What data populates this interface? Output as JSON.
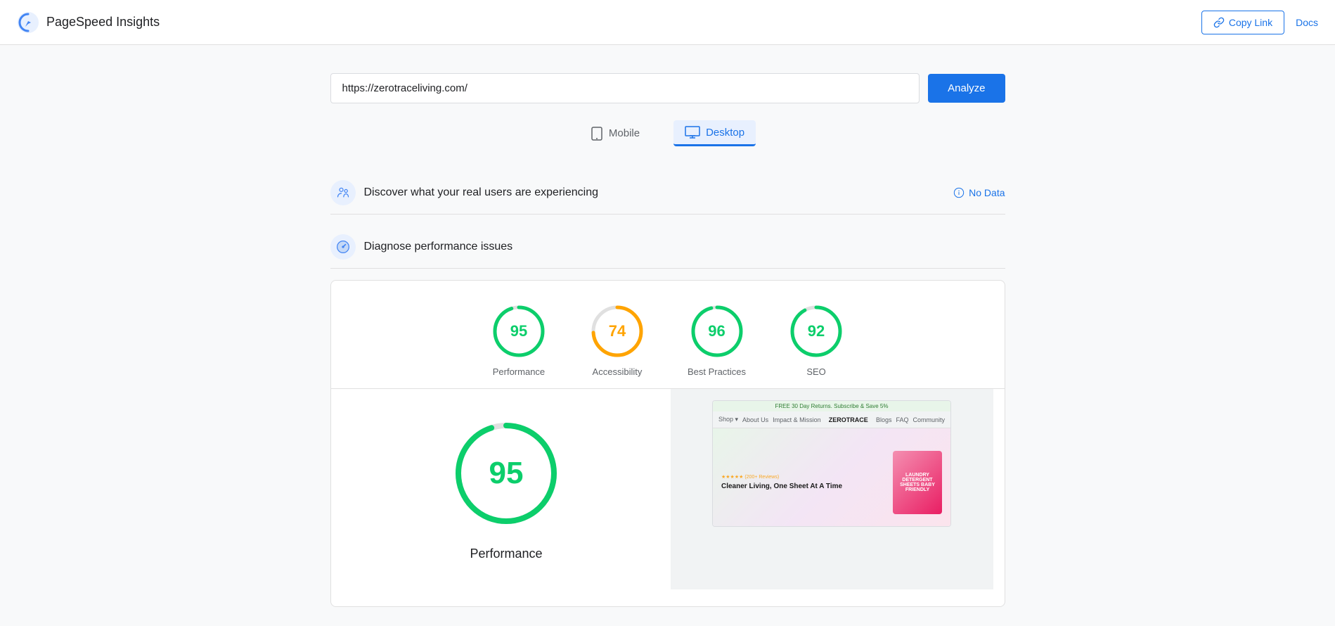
{
  "header": {
    "app_title": "PageSpeed Insights",
    "copy_link_label": "Copy Link",
    "docs_label": "Docs"
  },
  "search": {
    "url_value": "https://zerotraceliving.com/",
    "url_placeholder": "Enter a web page URL",
    "analyze_label": "Analyze"
  },
  "device_tabs": [
    {
      "id": "mobile",
      "label": "Mobile",
      "active": false
    },
    {
      "id": "desktop",
      "label": "Desktop",
      "active": true
    }
  ],
  "sections": {
    "discover": {
      "title": "Discover what your real users are experiencing",
      "no_data_label": "No Data"
    },
    "diagnose": {
      "title": "Diagnose performance issues"
    }
  },
  "scores": [
    {
      "id": "performance",
      "value": "95",
      "label": "Performance",
      "color": "#0cce6b",
      "stroke": "#0cce6b",
      "bg": "#fff",
      "pct": 95
    },
    {
      "id": "accessibility",
      "value": "74",
      "label": "Accessibility",
      "color": "#ffa400",
      "stroke": "#ffa400",
      "bg": "#fff",
      "pct": 74
    },
    {
      "id": "best-practices",
      "value": "96",
      "label": "Best Practices",
      "color": "#0cce6b",
      "stroke": "#0cce6b",
      "bg": "#fff",
      "pct": 96
    },
    {
      "id": "seo",
      "value": "92",
      "label": "SEO",
      "color": "#0cce6b",
      "stroke": "#0cce6b",
      "bg": "#fff",
      "pct": 92
    }
  ],
  "big_score": {
    "value": "95",
    "label": "Performance"
  },
  "screenshot": {
    "site_name": "ZEROTRACE",
    "headline": "Cleaner Living, One Sheet At A Time",
    "product_label": "LAUNDRY DETERGENT SHEETS BABY FRIENDLY",
    "banner_text": "FREE 30 Day Returns. Subscribe & Save 5%"
  },
  "colors": {
    "green": "#0cce6b",
    "orange": "#ffa400",
    "blue": "#1a73e8",
    "gray": "#5f6368"
  }
}
